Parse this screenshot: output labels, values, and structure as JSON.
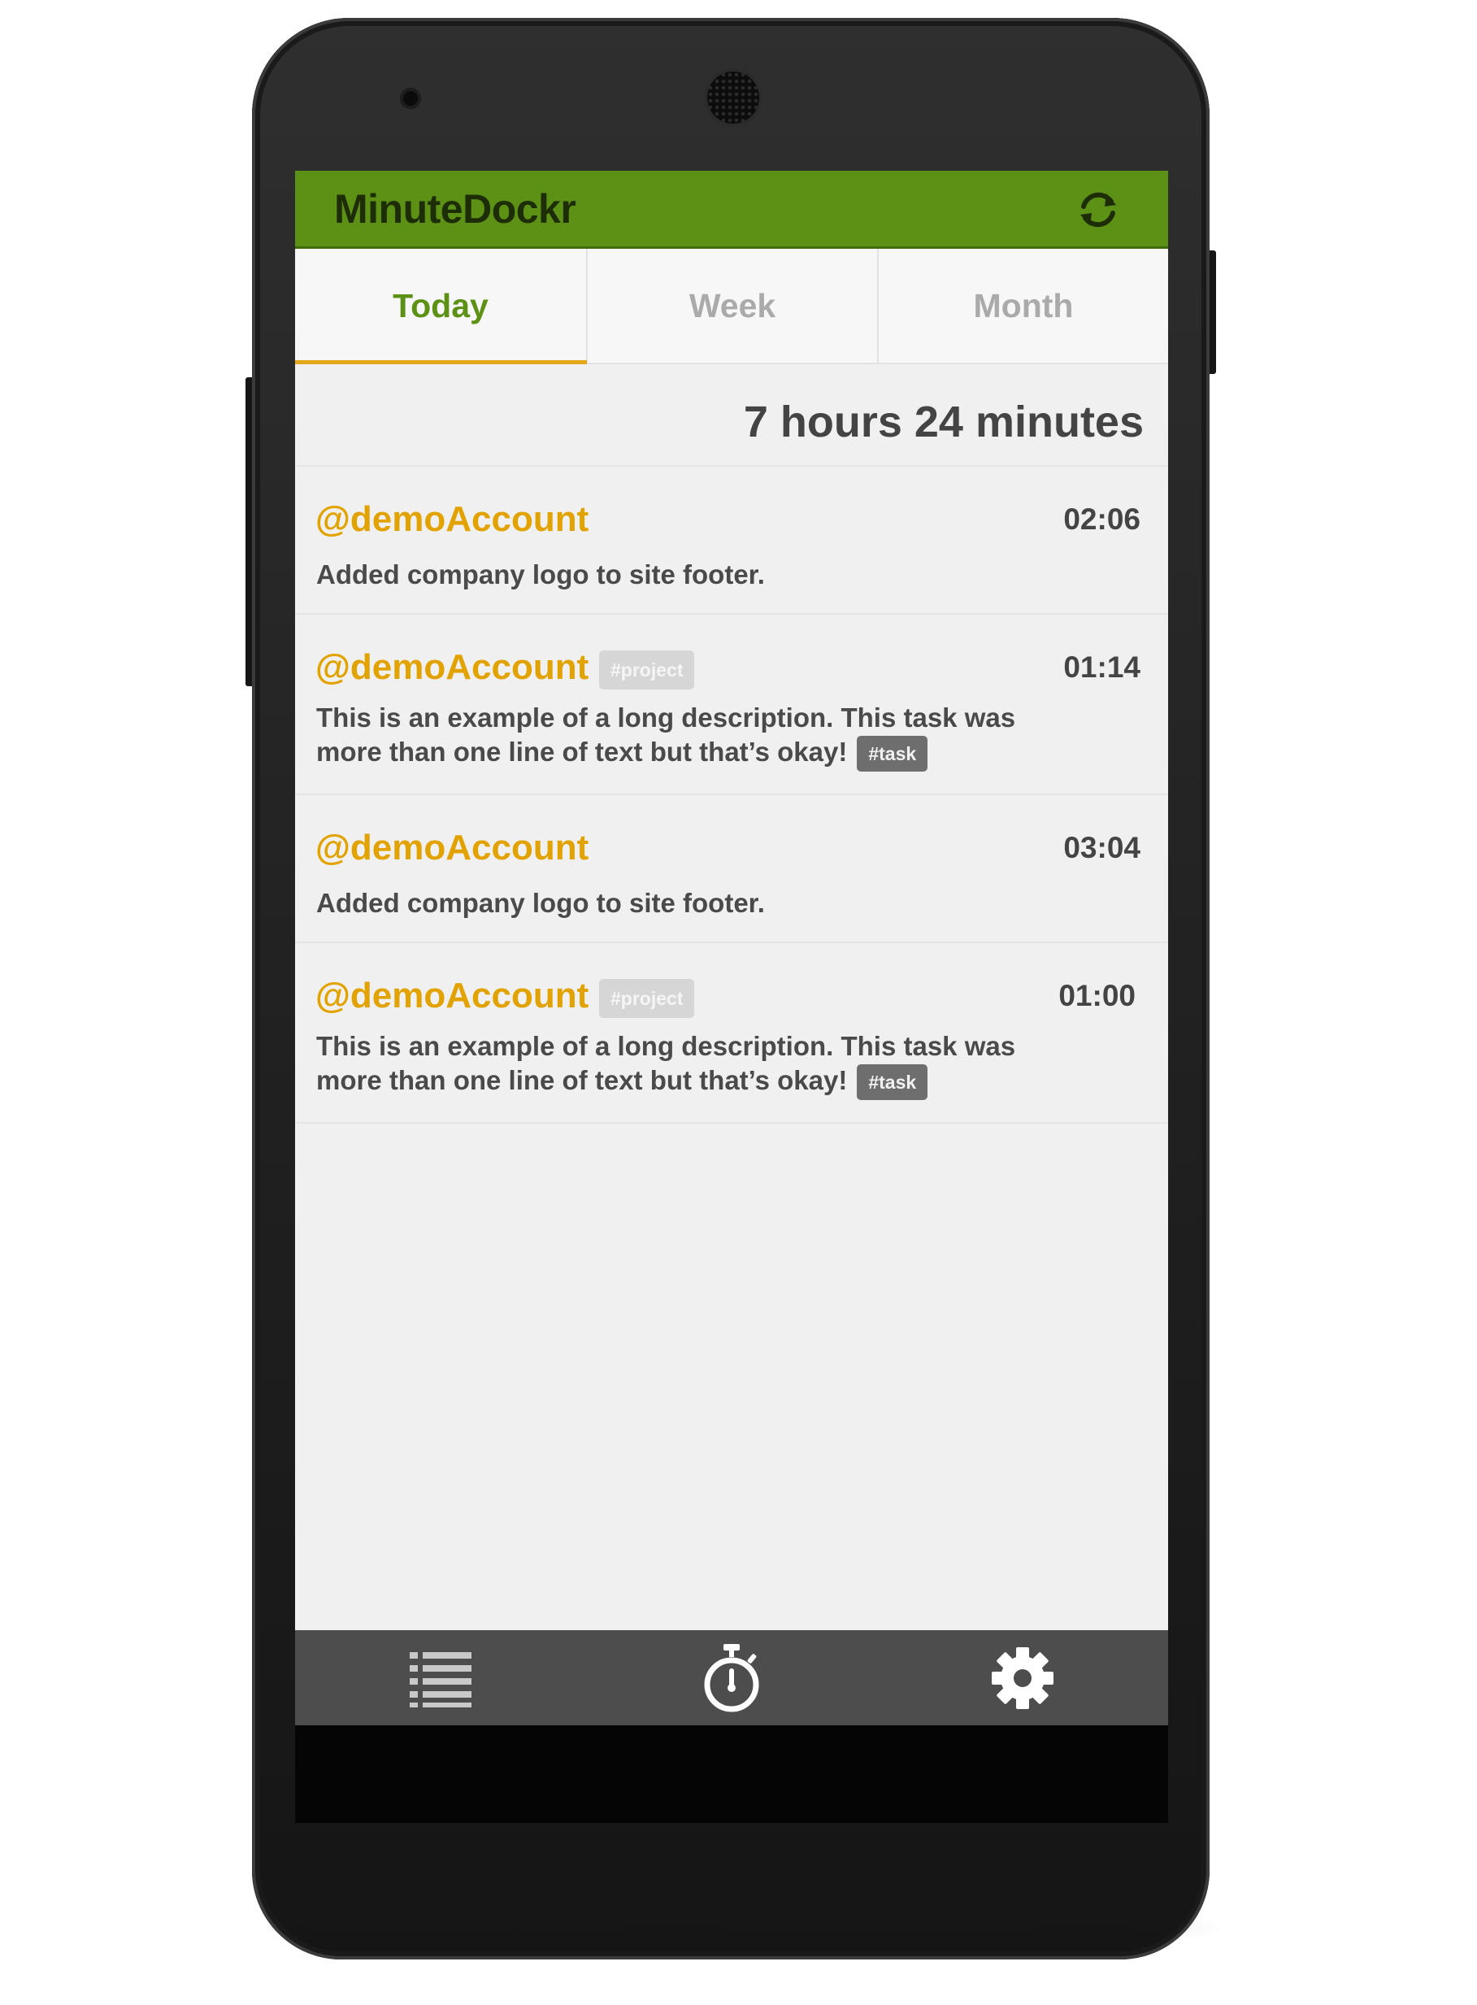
{
  "app": {
    "title": "MinuteDockr",
    "brand_color": "#5d9116",
    "accent_color": "#e2a200"
  },
  "header": {
    "refresh_icon": "refresh-icon"
  },
  "tabs": [
    {
      "label": "Today",
      "active": true
    },
    {
      "label": "Week",
      "active": false
    },
    {
      "label": "Month",
      "active": false
    }
  ],
  "summary": {
    "total": "7 hours 24 minutes"
  },
  "entries": [
    {
      "account": "@demoAccount",
      "project": "",
      "time": "02:06",
      "description": "Added company logo to site footer.",
      "task": ""
    },
    {
      "account": "@demoAccount",
      "project": "#project",
      "time": "01:14",
      "description": "This is an example of a long description. This task was more than one line of text but that’s okay!",
      "task": "#task"
    },
    {
      "account": "@demoAccount",
      "project": "",
      "time": "03:04",
      "description": "Added company logo to site footer.",
      "task": ""
    },
    {
      "account": "@demoAccount",
      "project": "#project",
      "time": "01:00",
      "description": "This is an example of a long description. This task was more than one line of text but that’s okay!",
      "task": "#task"
    }
  ],
  "bottom_nav": [
    {
      "icon": "list-icon"
    },
    {
      "icon": "stopwatch-icon"
    },
    {
      "icon": "gear-icon"
    }
  ]
}
